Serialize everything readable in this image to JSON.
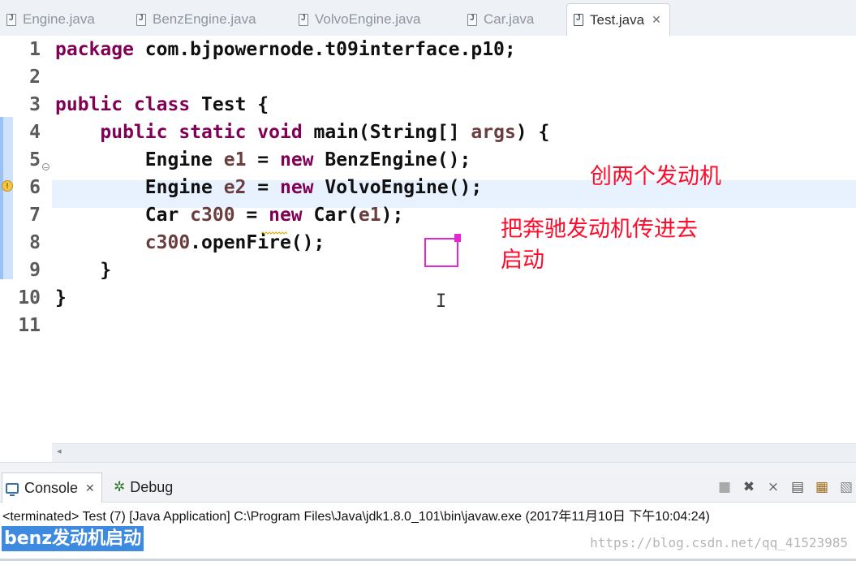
{
  "editor_tabs": [
    {
      "label": "Engine.java",
      "active": false
    },
    {
      "label": "BenzEngine.java",
      "active": false
    },
    {
      "label": "VolvoEngine.java",
      "active": false
    },
    {
      "label": "Car.java",
      "active": false
    },
    {
      "label": "Test.java",
      "active": true
    }
  ],
  "code": {
    "line_numbers": [
      "1",
      "2",
      "3",
      "4",
      "5",
      "6",
      "7",
      "8",
      "9",
      "10",
      "11"
    ],
    "lines": [
      "package com.bjpowernode.t09interface.p10;",
      "",
      "public class Test {",
      "    public static void main(String[] args) {",
      "        Engine e1 = new BenzEngine();",
      "        Engine e2 = new VolvoEngine();",
      "        Car c300 = new Car(e1);",
      "        c300.openFire();",
      "    }",
      "}",
      ""
    ],
    "current_line": 5
  },
  "annotations": {
    "note1": "创两个发动机",
    "note2_line1": "把奔驰发动机传进去",
    "note2_line2": "启动"
  },
  "console": {
    "tabs": [
      {
        "label": "Console",
        "icon": "console-icon",
        "active": true
      },
      {
        "label": "Debug",
        "icon": "debug-icon",
        "active": false
      }
    ],
    "status": "<terminated> Test (7) [Java Application] C:\\Program Files\\Java\\jdk1.8.0_101\\bin\\javaw.exe (2017年11月10日 下午10:04:24)",
    "output": "benz发动机启动"
  },
  "watermark": "https://blog.csdn.net/qq_41523985",
  "colors": {
    "keyword": "#7f0055",
    "annotation": "#ff0a2a",
    "highlight_box": "#e426d6",
    "selection": "#3d8ae0"
  }
}
